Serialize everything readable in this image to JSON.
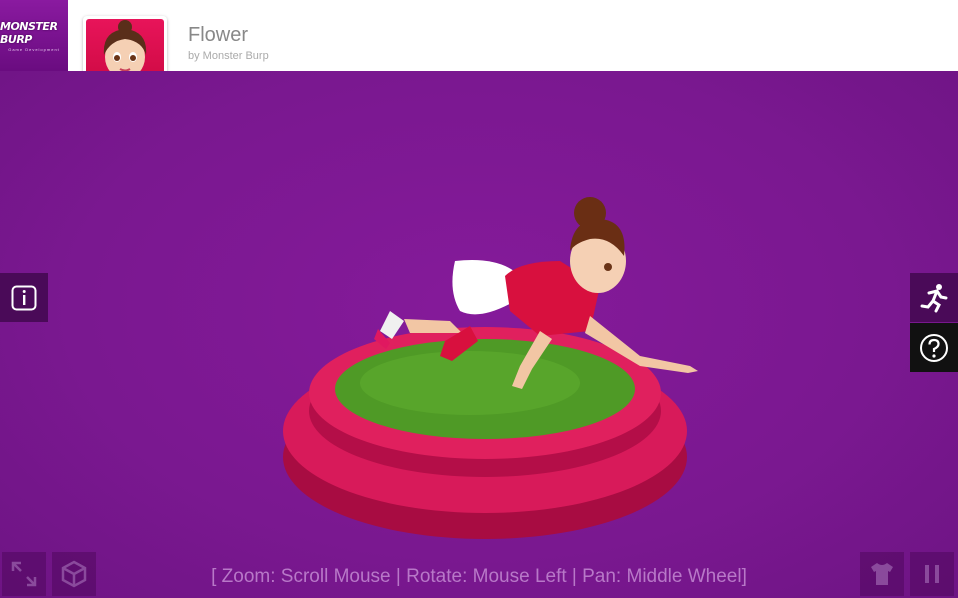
{
  "header": {
    "logo_text": "MONSTER BURP",
    "logo_subtext": "Game Development",
    "title": "Flower",
    "byline": "by Monster Burp"
  },
  "viewer": {
    "hint": "[ Zoom: Scroll Mouse | Rotate: Mouse Left | Pan: Middle Wheel]"
  },
  "controls": {
    "info_icon": "info-icon",
    "animation_icon": "running-person-icon",
    "help_icon": "question-icon",
    "fullscreen_icon": "expand-icon",
    "unity_icon": "unity-logo-icon",
    "outfit_icon": "tshirt-icon",
    "pause_icon": "pause-icon"
  },
  "colors": {
    "background": "#7a1890",
    "platform": "#d81a5a",
    "grass": "#4f9a26",
    "dark_button": "#4a0a58"
  }
}
